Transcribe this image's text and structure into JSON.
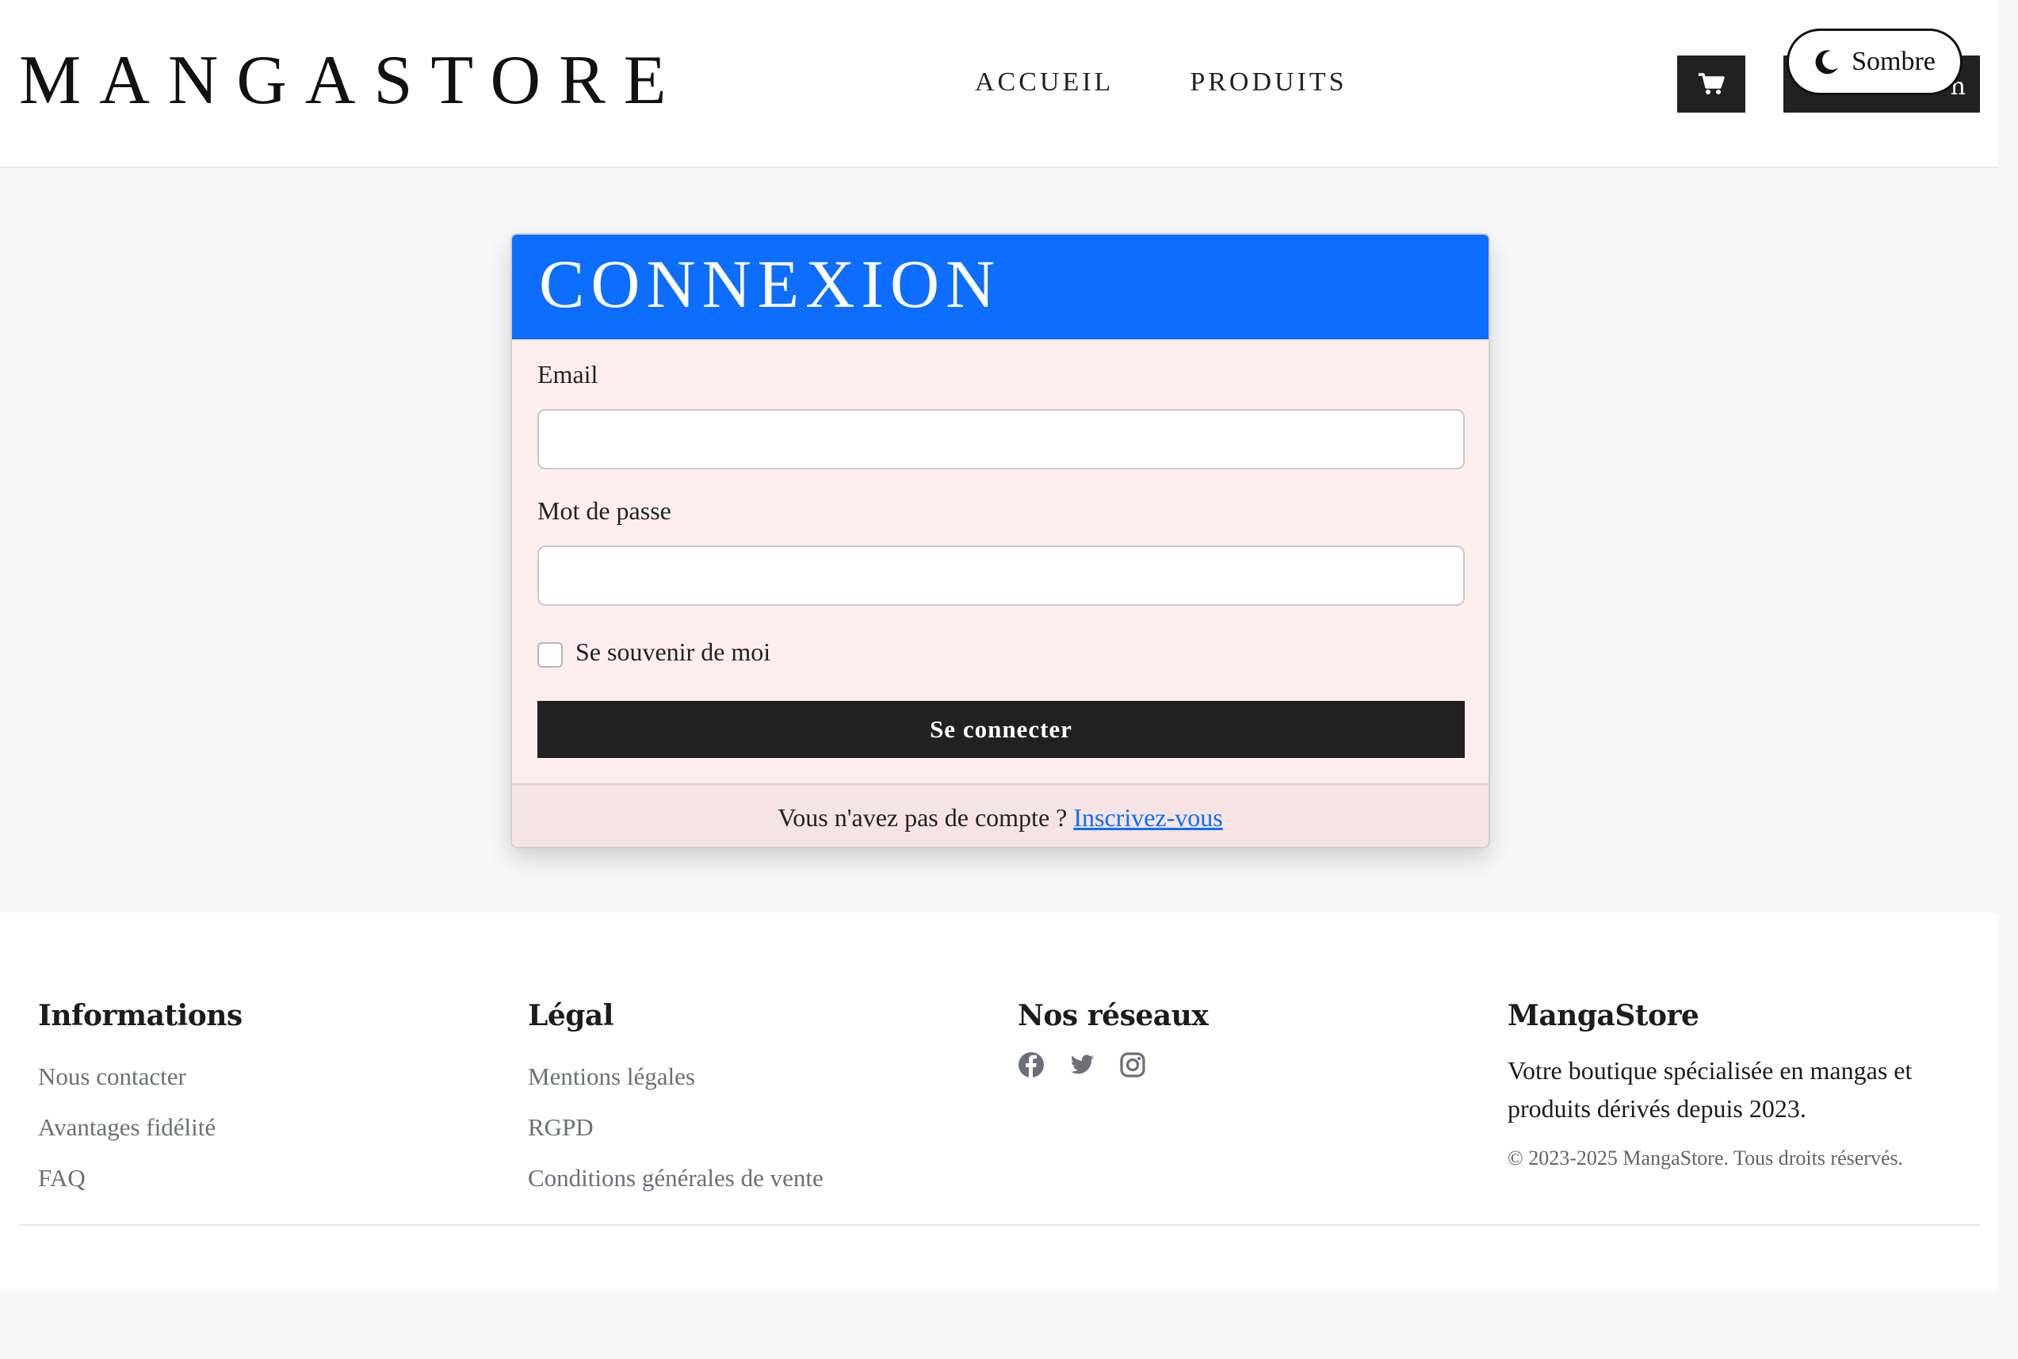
{
  "header": {
    "logo": "MANGASTORE",
    "nav": [
      "ACCUEIL",
      "PRODUITS"
    ],
    "cart_icon": "cart-icon",
    "dark_button_partial": "n",
    "theme_toggle": {
      "icon": "moon-icon",
      "label": "Sombre"
    }
  },
  "login": {
    "title": "CONNEXION",
    "email_label": "Email",
    "email_value": "",
    "password_label": "Mot de passe",
    "password_value": "",
    "remember_label": "Se souvenir de moi",
    "remember_checked": false,
    "submit_label": "Se connecter",
    "footer_text": "Vous n'avez pas de compte ? ",
    "footer_link": "Inscrivez-vous"
  },
  "footer": {
    "columns": [
      {
        "title": "Informations",
        "links": [
          "Nous contacter",
          "Avantages fidélité",
          "FAQ"
        ]
      },
      {
        "title": "Légal",
        "links": [
          "Mentions légales",
          "RGPD",
          "Conditions générales de vente"
        ]
      },
      {
        "title": "Nos réseaux",
        "icons": [
          "facebook-icon",
          "twitter-icon",
          "instagram-icon"
        ]
      },
      {
        "title": "MangaStore",
        "text": "Votre boutique spécialisée en mangas et produits dérivés depuis 2023.",
        "copyright": "© 2023-2025 MangaStore. Tous droits réservés."
      }
    ]
  },
  "colors": {
    "primary": "#0d6efd",
    "dark": "#212121",
    "card_bg": "#fdeeed",
    "muted_link": "#6a6f78"
  }
}
